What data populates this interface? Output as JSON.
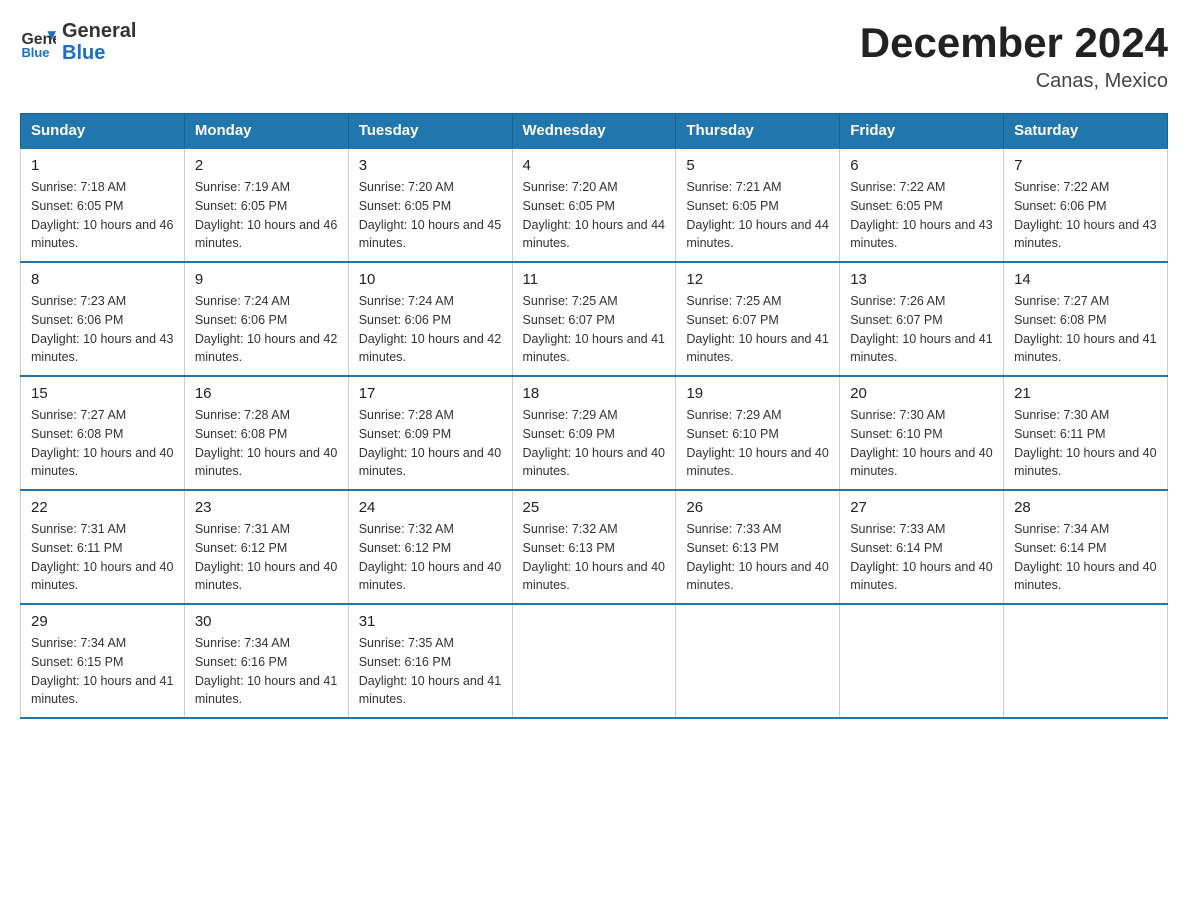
{
  "header": {
    "logo": {
      "line1": "General",
      "line2": "Blue"
    },
    "title": "December 2024",
    "location": "Canas, Mexico"
  },
  "weekdays": [
    "Sunday",
    "Monday",
    "Tuesday",
    "Wednesday",
    "Thursday",
    "Friday",
    "Saturday"
  ],
  "weeks": [
    [
      {
        "day": "1",
        "sunrise": "7:18 AM",
        "sunset": "6:05 PM",
        "daylight": "10 hours and 46 minutes."
      },
      {
        "day": "2",
        "sunrise": "7:19 AM",
        "sunset": "6:05 PM",
        "daylight": "10 hours and 46 minutes."
      },
      {
        "day": "3",
        "sunrise": "7:20 AM",
        "sunset": "6:05 PM",
        "daylight": "10 hours and 45 minutes."
      },
      {
        "day": "4",
        "sunrise": "7:20 AM",
        "sunset": "6:05 PM",
        "daylight": "10 hours and 44 minutes."
      },
      {
        "day": "5",
        "sunrise": "7:21 AM",
        "sunset": "6:05 PM",
        "daylight": "10 hours and 44 minutes."
      },
      {
        "day": "6",
        "sunrise": "7:22 AM",
        "sunset": "6:05 PM",
        "daylight": "10 hours and 43 minutes."
      },
      {
        "day": "7",
        "sunrise": "7:22 AM",
        "sunset": "6:06 PM",
        "daylight": "10 hours and 43 minutes."
      }
    ],
    [
      {
        "day": "8",
        "sunrise": "7:23 AM",
        "sunset": "6:06 PM",
        "daylight": "10 hours and 43 minutes."
      },
      {
        "day": "9",
        "sunrise": "7:24 AM",
        "sunset": "6:06 PM",
        "daylight": "10 hours and 42 minutes."
      },
      {
        "day": "10",
        "sunrise": "7:24 AM",
        "sunset": "6:06 PM",
        "daylight": "10 hours and 42 minutes."
      },
      {
        "day": "11",
        "sunrise": "7:25 AM",
        "sunset": "6:07 PM",
        "daylight": "10 hours and 41 minutes."
      },
      {
        "day": "12",
        "sunrise": "7:25 AM",
        "sunset": "6:07 PM",
        "daylight": "10 hours and 41 minutes."
      },
      {
        "day": "13",
        "sunrise": "7:26 AM",
        "sunset": "6:07 PM",
        "daylight": "10 hours and 41 minutes."
      },
      {
        "day": "14",
        "sunrise": "7:27 AM",
        "sunset": "6:08 PM",
        "daylight": "10 hours and 41 minutes."
      }
    ],
    [
      {
        "day": "15",
        "sunrise": "7:27 AM",
        "sunset": "6:08 PM",
        "daylight": "10 hours and 40 minutes."
      },
      {
        "day": "16",
        "sunrise": "7:28 AM",
        "sunset": "6:08 PM",
        "daylight": "10 hours and 40 minutes."
      },
      {
        "day": "17",
        "sunrise": "7:28 AM",
        "sunset": "6:09 PM",
        "daylight": "10 hours and 40 minutes."
      },
      {
        "day": "18",
        "sunrise": "7:29 AM",
        "sunset": "6:09 PM",
        "daylight": "10 hours and 40 minutes."
      },
      {
        "day": "19",
        "sunrise": "7:29 AM",
        "sunset": "6:10 PM",
        "daylight": "10 hours and 40 minutes."
      },
      {
        "day": "20",
        "sunrise": "7:30 AM",
        "sunset": "6:10 PM",
        "daylight": "10 hours and 40 minutes."
      },
      {
        "day": "21",
        "sunrise": "7:30 AM",
        "sunset": "6:11 PM",
        "daylight": "10 hours and 40 minutes."
      }
    ],
    [
      {
        "day": "22",
        "sunrise": "7:31 AM",
        "sunset": "6:11 PM",
        "daylight": "10 hours and 40 minutes."
      },
      {
        "day": "23",
        "sunrise": "7:31 AM",
        "sunset": "6:12 PM",
        "daylight": "10 hours and 40 minutes."
      },
      {
        "day": "24",
        "sunrise": "7:32 AM",
        "sunset": "6:12 PM",
        "daylight": "10 hours and 40 minutes."
      },
      {
        "day": "25",
        "sunrise": "7:32 AM",
        "sunset": "6:13 PM",
        "daylight": "10 hours and 40 minutes."
      },
      {
        "day": "26",
        "sunrise": "7:33 AM",
        "sunset": "6:13 PM",
        "daylight": "10 hours and 40 minutes."
      },
      {
        "day": "27",
        "sunrise": "7:33 AM",
        "sunset": "6:14 PM",
        "daylight": "10 hours and 40 minutes."
      },
      {
        "day": "28",
        "sunrise": "7:34 AM",
        "sunset": "6:14 PM",
        "daylight": "10 hours and 40 minutes."
      }
    ],
    [
      {
        "day": "29",
        "sunrise": "7:34 AM",
        "sunset": "6:15 PM",
        "daylight": "10 hours and 41 minutes."
      },
      {
        "day": "30",
        "sunrise": "7:34 AM",
        "sunset": "6:16 PM",
        "daylight": "10 hours and 41 minutes."
      },
      {
        "day": "31",
        "sunrise": "7:35 AM",
        "sunset": "6:16 PM",
        "daylight": "10 hours and 41 minutes."
      },
      null,
      null,
      null,
      null
    ]
  ]
}
